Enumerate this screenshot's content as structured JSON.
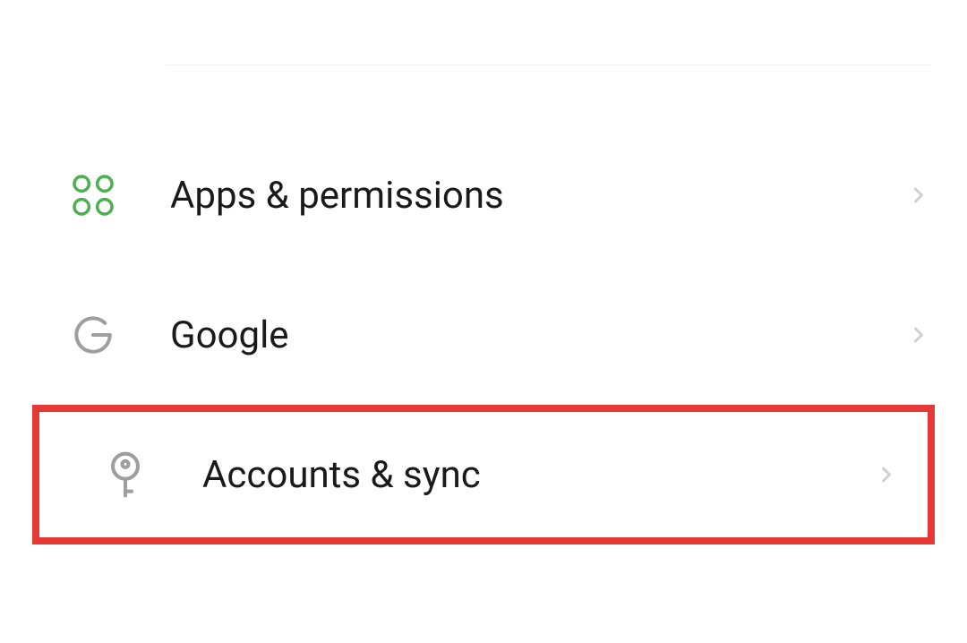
{
  "settings": {
    "items": [
      {
        "label": "Apps & permissions",
        "icon": "apps-icon"
      },
      {
        "label": "Google",
        "icon": "google-icon"
      },
      {
        "label": "Accounts & sync",
        "icon": "key-icon"
      }
    ]
  },
  "colors": {
    "apps_icon": "#4caf50",
    "google_icon": "#9e9e9e",
    "key_icon": "#9e9e9e",
    "chevron": "#cfcfcf",
    "highlight_border": "#e53935"
  }
}
